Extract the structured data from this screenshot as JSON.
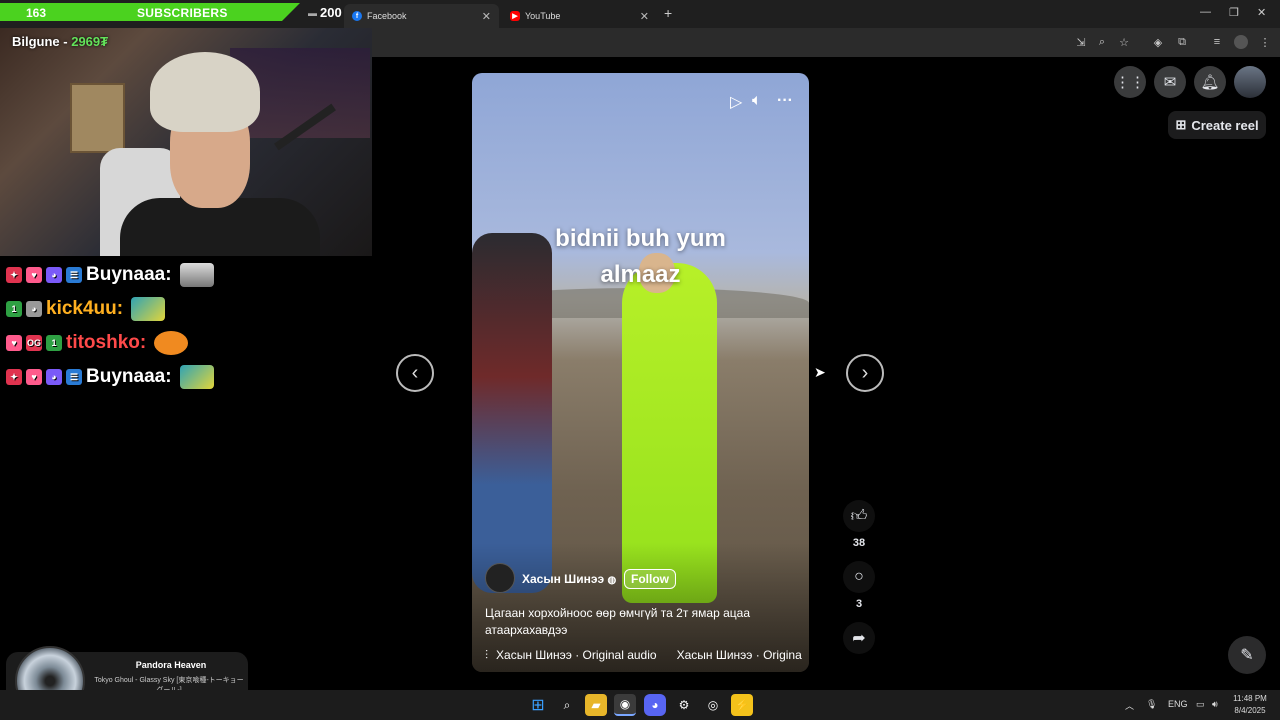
{
  "subscriber_bar": {
    "count": "163",
    "label": "SUBSCRIBERS",
    "goal": "200"
  },
  "streamer": {
    "name": "Bilgune - ",
    "points": "2969₮"
  },
  "tabs": [
    {
      "label": "Facebook",
      "icon": "facebook-icon",
      "active": true
    },
    {
      "label": "YouTube",
      "icon": "youtube-icon",
      "active": false
    }
  ],
  "chat": [
    {
      "user": "Buynaaa:",
      "color": "#ffffff"
    },
    {
      "user": "kick4uu:",
      "color": "#ffb020"
    },
    {
      "user": "titoshko:",
      "color": "#ff4a4a"
    },
    {
      "user": "Buynaaa:",
      "color": "#ffffff"
    }
  ],
  "now_playing": {
    "title": "Pandora Heaven",
    "subtitle": "Tokyo Ghoul - Glassy Sky [東京喰種-トーキョーグール-]"
  },
  "reel": {
    "overlay_text": "bidnii buh yum almaaz",
    "author": "Хасын Шинээ",
    "follow_label": "Follow",
    "caption": "Цагаан хорхойноос өөр өмчгүй та 2т ямар ацаа атаархахавдээ",
    "audio": "Хасын Шинээ · Original audio      Хасын Шинээ · Origina",
    "likes": "38",
    "comments": "3"
  },
  "header": {
    "create_reel_label": "Create reel"
  },
  "taskbar": {
    "lang": "ENG",
    "time": "11:48 PM",
    "date": "8/4/2025"
  },
  "colors": {
    "sub_green": "#4bd21f",
    "fb_bg": "#000000",
    "accent_neon": "#9be21c"
  }
}
